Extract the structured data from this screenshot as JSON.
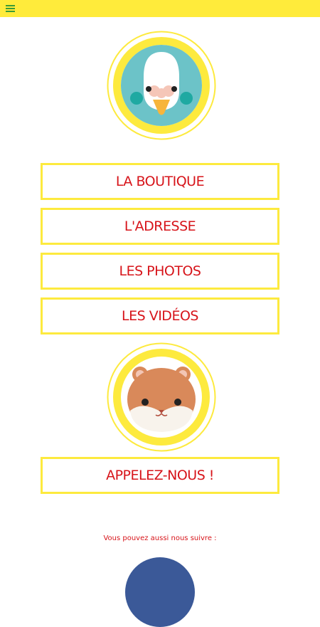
{
  "header": {
    "menu_icon": "hamburger-menu-icon"
  },
  "colors": {
    "accent_yellow": "#ffeb3b",
    "border_yellow": "#fdea3e",
    "text_red": "#d7141a",
    "menu_green": "#3a9b36",
    "facebook_blue": "#3b5998"
  },
  "images": {
    "top": "budgie-bird-icon",
    "middle": "hamster-face-icon"
  },
  "buttons": {
    "boutique": "LA BOUTIQUE",
    "adresse": "L'ADRESSE",
    "photos": "LES PHOTOS",
    "videos": "LES VIDÉOS",
    "call": "APPELEZ-NOUS !"
  },
  "footer": {
    "follow_text": "Vous pouvez aussi nous suivre :",
    "social_icon": "facebook-icon"
  }
}
